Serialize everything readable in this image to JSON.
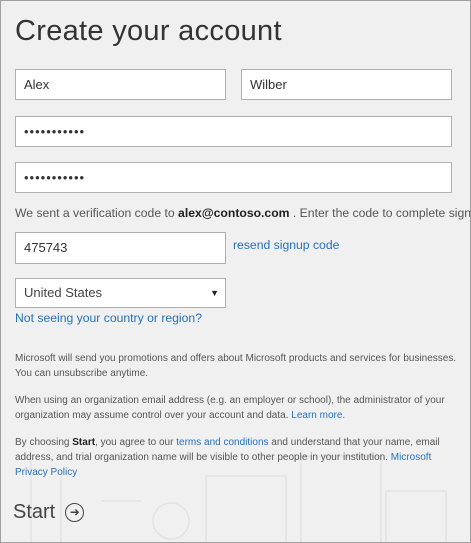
{
  "title": "Create your account",
  "form": {
    "first_name": "Alex",
    "last_name": "Wilber",
    "password_masked": "•••••••••••",
    "confirm_password_masked": "•••••••••••",
    "verify_prefix": "We sent a verification code to",
    "verify_email": "alex@contoso.com",
    "verify_suffix": ". Enter the code to complete signup.",
    "code": "475743",
    "resend_label": "resend signup code",
    "country": "United States",
    "country_link": "Not seeing your country or region?"
  },
  "legal": {
    "promo": "Microsoft will send you promotions and offers about Microsoft products and services for businesses. You can unsubscribe anytime.",
    "org_prefix": "When using an organization email address (e.g. an employer or school), the administrator of your organization may assume control over your account and data.",
    "learn_more": "Learn more.",
    "terms_prefix": "By choosing",
    "terms_start_word": "Start",
    "terms_middle": ", you agree to our",
    "terms_link": "terms and conditions",
    "terms_suffix": "and understand that your name, email address, and trial organization name will be visible to other people in your institution.",
    "privacy_link": "Microsoft Privacy Policy"
  },
  "actions": {
    "start_label": "Start",
    "start_icon": "arrow-right-circle"
  },
  "colors": {
    "link": "#2672bb",
    "background": "#f0f0f0"
  }
}
